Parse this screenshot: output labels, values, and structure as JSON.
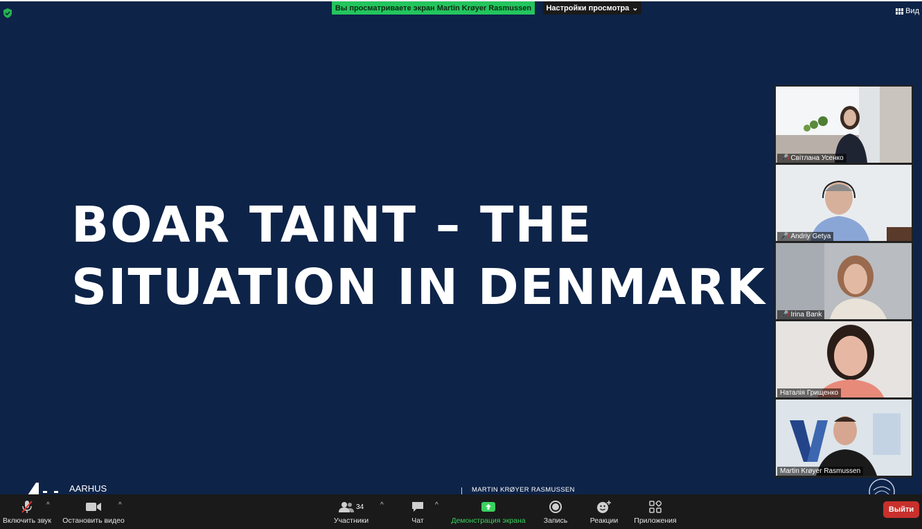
{
  "banner": {
    "viewing_text": "Вы просматриваете экран Martin Krøyer Rasmussen",
    "view_settings_label": "Настройки просмотра",
    "view_label": "Вид"
  },
  "slide": {
    "title": "BOAR TAINT – THE\nSITUATION IN DENMARK",
    "university": "AARHUS",
    "presenter": "MARTIN KRØYER RASMUSSEN"
  },
  "participants": [
    {
      "name": "Світлана Усенко",
      "muted": true
    },
    {
      "name": "Andriy Getya",
      "muted": true
    },
    {
      "name": "Irina Bank",
      "muted": true
    },
    {
      "name": "Наталія Грищенко",
      "muted": false
    },
    {
      "name": "Martin Krøyer Rasmussen",
      "muted": false
    }
  ],
  "toolbar": {
    "unmute_label": "Включить звук",
    "stop_video_label": "Остановить видео",
    "participants_label": "Участники",
    "participants_count": "34",
    "chat_label": "Чат",
    "share_screen_label": "Демонстрация экрана",
    "record_label": "Запись",
    "reactions_label": "Реакции",
    "apps_label": "Приложения",
    "leave_label": "Выйти"
  },
  "colors": {
    "slide_background": "#0d2348",
    "banner_green": "#23c55e",
    "toolbar_background": "#1a1a1a",
    "leave_red": "#c8302c",
    "share_green": "#3ad15e"
  }
}
